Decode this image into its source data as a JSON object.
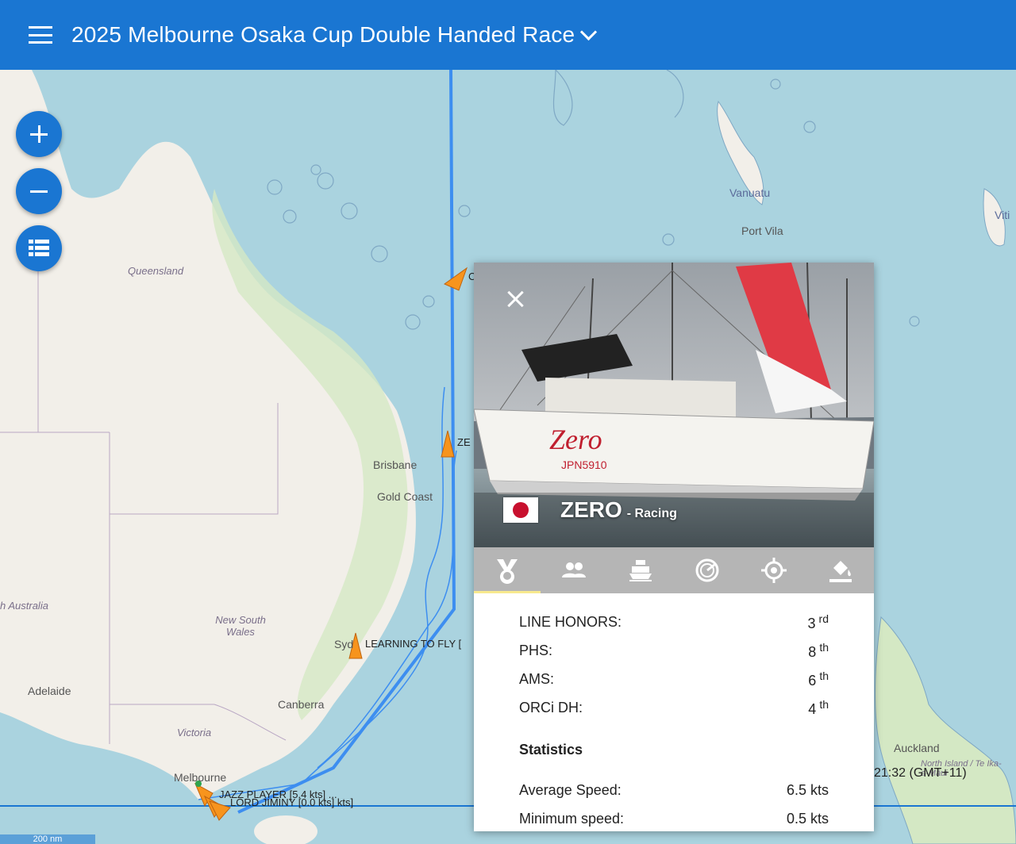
{
  "header": {
    "title": "2025 Melbourne Osaka Cup Double Handed Race"
  },
  "map": {
    "labels": {
      "queensland": "Queensland",
      "vanuatu": "Vanuatu",
      "port_vila": "Port Vila",
      "brisbane": "Brisbane",
      "gold_coast": "Gold Coast",
      "new_south_wales": "New South Wales",
      "south_australia": "h Australia",
      "adelaide": "Adelaide",
      "canberra": "Canberra",
      "victoria": "Victoria",
      "melbourne": "Melbourne",
      "auckland": "Auckland",
      "north_island": "North Island / Te Ika-a-Māui",
      "sydney": "Syd",
      "viti": "Viti"
    },
    "boats": {
      "north": "C",
      "zero": "ZE",
      "learning": "LEARNING TO FLY [",
      "jazz": "JAZZ PLAYER [5.4 kts] ...",
      "lord": "LORD JIMINY [0.0 kts] kts]"
    },
    "time_text": "21:32 (GMT+11)",
    "scale_text": "200 nm"
  },
  "panel": {
    "name": "ZERO",
    "status": "- Racing",
    "flag": "japan-flag",
    "tabs": [
      "medal-icon",
      "crew-icon",
      "boat-icon",
      "speed-icon",
      "position-icon",
      "paint-icon"
    ],
    "rankings": [
      {
        "label": "LINE HONORS:",
        "value": "3",
        "suffix": "rd"
      },
      {
        "label": "PHS:",
        "value": "8",
        "suffix": "th"
      },
      {
        "label": "AMS:",
        "value": "6",
        "suffix": "th"
      },
      {
        "label": "ORCi DH:",
        "value": "4",
        "suffix": "th"
      }
    ],
    "statistics_title": "Statistics",
    "statistics": [
      {
        "label": "Average Speed:",
        "value": "6.5 kts"
      },
      {
        "label": "Minimum speed:",
        "value": "0.5 kts"
      }
    ]
  },
  "colors": {
    "header": "#1a76d2",
    "sea": "#aad3df",
    "land": "#f2efe9",
    "route": "#3d8ef0",
    "boat": "#f7941d"
  }
}
